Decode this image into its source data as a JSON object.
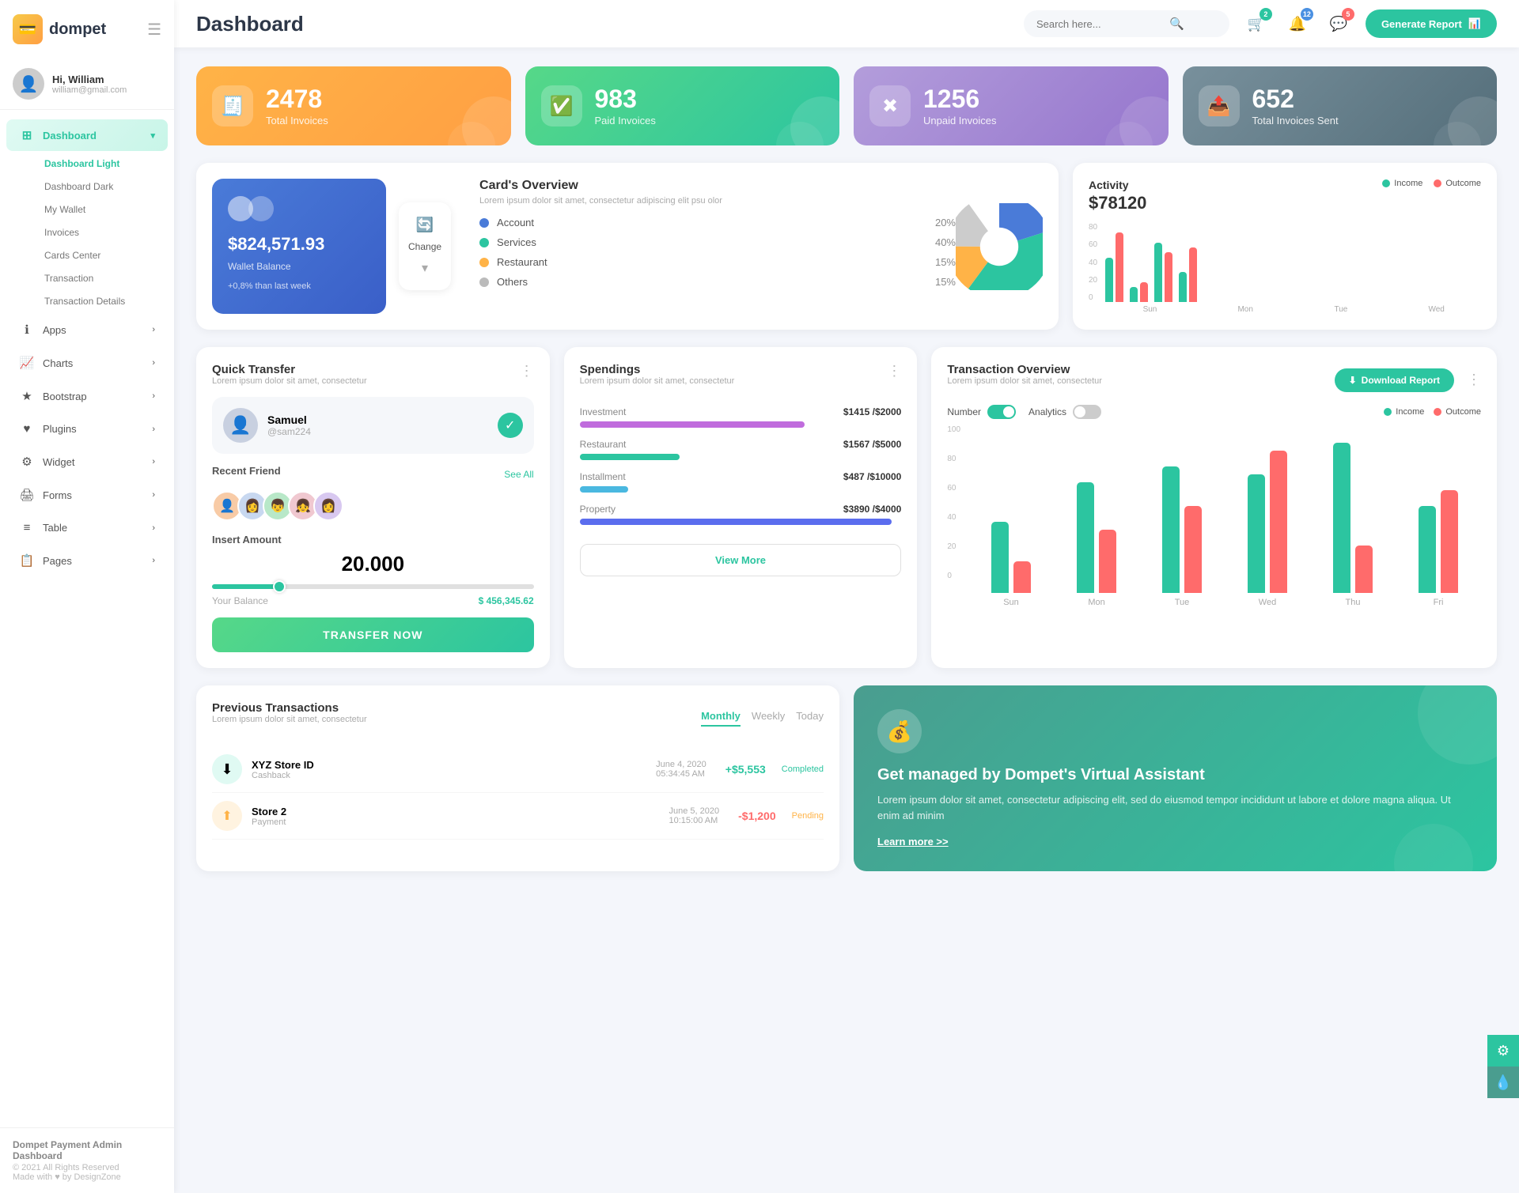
{
  "logo": {
    "text": "dompet"
  },
  "header": {
    "title": "Dashboard",
    "search_placeholder": "Search here...",
    "generate_btn": "Generate Report",
    "notification_count": "2",
    "bell_count": "12",
    "chat_count": "5"
  },
  "user": {
    "name": "Hi, William",
    "email": "william@gmail.com"
  },
  "sidebar": {
    "nav": [
      {
        "label": "Dashboard",
        "icon": "⊞",
        "active": true,
        "arrow": "▾"
      },
      {
        "label": "Dashboard Light",
        "sub": true,
        "active_sub": true
      },
      {
        "label": "Dashboard Dark",
        "sub": true
      },
      {
        "label": "My Wallet",
        "sub": true
      },
      {
        "label": "Invoices",
        "sub": true
      },
      {
        "label": "Cards Center",
        "sub": true
      },
      {
        "label": "Transaction",
        "sub": true
      },
      {
        "label": "Transaction Details",
        "sub": true
      },
      {
        "label": "Apps",
        "icon": "ℹ",
        "arrow": "›"
      },
      {
        "label": "Charts",
        "icon": "📈",
        "arrow": "›"
      },
      {
        "label": "Bootstrap",
        "icon": "★",
        "arrow": "›"
      },
      {
        "label": "Plugins",
        "icon": "♥",
        "arrow": "›"
      },
      {
        "label": "Widget",
        "icon": "⚙",
        "arrow": "›"
      },
      {
        "label": "Forms",
        "icon": "🖨",
        "arrow": "›"
      },
      {
        "label": "Table",
        "icon": "≡",
        "arrow": "›"
      },
      {
        "label": "Pages",
        "icon": "📋",
        "arrow": "›"
      }
    ],
    "footer_brand": "Dompet Payment Admin Dashboard",
    "footer_copy": "© 2021 All Rights Reserved",
    "footer_made": "Made with ♥ by DesignZone"
  },
  "stats": [
    {
      "num": "2478",
      "label": "Total Invoices",
      "icon": "🧾",
      "color": "orange"
    },
    {
      "num": "983",
      "label": "Paid Invoices",
      "icon": "✅",
      "color": "green"
    },
    {
      "num": "1256",
      "label": "Unpaid Invoices",
      "icon": "✖",
      "color": "purple"
    },
    {
      "num": "652",
      "label": "Total Invoices Sent",
      "icon": "📤",
      "color": "slate"
    }
  ],
  "wallet": {
    "amount": "$824,571.93",
    "label": "Wallet Balance",
    "change": "+0,8% than last week",
    "change_btn": "Change"
  },
  "overview": {
    "title": "Card's Overview",
    "desc": "Lorem ipsum dolor sit amet, consectetur adipiscing elit psu olor",
    "items": [
      {
        "name": "Account",
        "pct": "20%",
        "color": "#4a7bd8"
      },
      {
        "name": "Services",
        "pct": "40%",
        "color": "#2cc5a0"
      },
      {
        "name": "Restaurant",
        "pct": "15%",
        "color": "#ffb347"
      },
      {
        "name": "Others",
        "pct": "15%",
        "color": "#bbb"
      }
    ]
  },
  "activity": {
    "title": "Activity",
    "amount": "$78120",
    "legend": [
      {
        "label": "Income",
        "color": "#2cc5a0"
      },
      {
        "label": "Outcome",
        "color": "#ff6b6b"
      }
    ],
    "bars": [
      {
        "day": "Sun",
        "income": 45,
        "outcome": 70
      },
      {
        "day": "Mon",
        "income": 15,
        "outcome": 20
      },
      {
        "day": "Tue",
        "income": 60,
        "outcome": 50
      },
      {
        "day": "Wed",
        "income": 30,
        "outcome": 55
      }
    ]
  },
  "quick_transfer": {
    "title": "Quick Transfer",
    "desc": "Lorem ipsum dolor sit amet, consectetur",
    "selected_user": {
      "name": "Samuel",
      "handle": "@sam224"
    },
    "recent_label": "Recent Friend",
    "see_more": "See All",
    "insert_label": "Insert Amount",
    "amount": "20.000",
    "balance_label": "Your Balance",
    "balance": "$ 456,345.62",
    "transfer_btn": "TRANSFER NOW",
    "friends": [
      "👤",
      "👩",
      "👦",
      "👧",
      "👩‍🦱"
    ]
  },
  "spendings": {
    "title": "Spendings",
    "desc": "Lorem ipsum dolor sit amet, consectetur",
    "items": [
      {
        "label": "Investment",
        "spent": "$1415",
        "total": "$2000",
        "pct": 70,
        "color": "#c06cdd"
      },
      {
        "label": "Restaurant",
        "spent": "$1567",
        "total": "$5000",
        "pct": 31,
        "color": "#2cc5a0"
      },
      {
        "label": "Installment",
        "spent": "$487",
        "total": "$10000",
        "pct": 15,
        "color": "#4ab8e0"
      },
      {
        "label": "Property",
        "spent": "$3890",
        "total": "$4000",
        "pct": 97,
        "color": "#5b6dee"
      }
    ],
    "view_more": "View More"
  },
  "transaction_overview": {
    "title": "Transaction Overview",
    "desc": "Lorem ipsum dolor sit amet, consectetur",
    "download_btn": "Download Report",
    "toggle_number": "Number",
    "toggle_analytics": "Analytics",
    "legend": [
      {
        "label": "Income",
        "color": "#2cc5a0"
      },
      {
        "label": "Outcome",
        "color": "#ff6b6b"
      }
    ],
    "bars": [
      {
        "day": "Sun",
        "income": 45,
        "outcome": 20
      },
      {
        "day": "Mon",
        "income": 70,
        "outcome": 40
      },
      {
        "day": "Tue",
        "income": 80,
        "outcome": 55
      },
      {
        "day": "Wed",
        "income": 75,
        "outcome": 90
      },
      {
        "day": "Thu",
        "income": 95,
        "outcome": 30
      },
      {
        "day": "Fri",
        "income": 55,
        "outcome": 65
      }
    ]
  },
  "prev_transactions": {
    "title": "Previous Transactions",
    "desc": "Lorem ipsum dolor sit amet, consectetur",
    "tabs": [
      "Monthly",
      "Weekly",
      "Today"
    ],
    "active_tab": "Monthly",
    "items": [
      {
        "name": "XYZ Store ID",
        "type": "Cashback",
        "date": "June 4, 2020",
        "time": "05:34:45 AM",
        "amount": "+$5,553",
        "status": "Completed",
        "icon": "⬇",
        "icon_color": "green-bg"
      },
      {
        "name": "Store 2",
        "type": "Payment",
        "date": "June 5, 2020",
        "time": "10:15:00 AM",
        "amount": "-$1,200",
        "status": "Pending",
        "icon": "⬆",
        "icon_color": "orange-bg"
      }
    ]
  },
  "virtual_assistant": {
    "title": "Get managed by Dompet's Virtual Assistant",
    "desc": "Lorem ipsum dolor sit amet, consectetur adipiscing elit, sed do eiusmod tempor incididunt ut labore et dolore magna aliqua. Ut enim ad minim",
    "link": "Learn more >>"
  }
}
